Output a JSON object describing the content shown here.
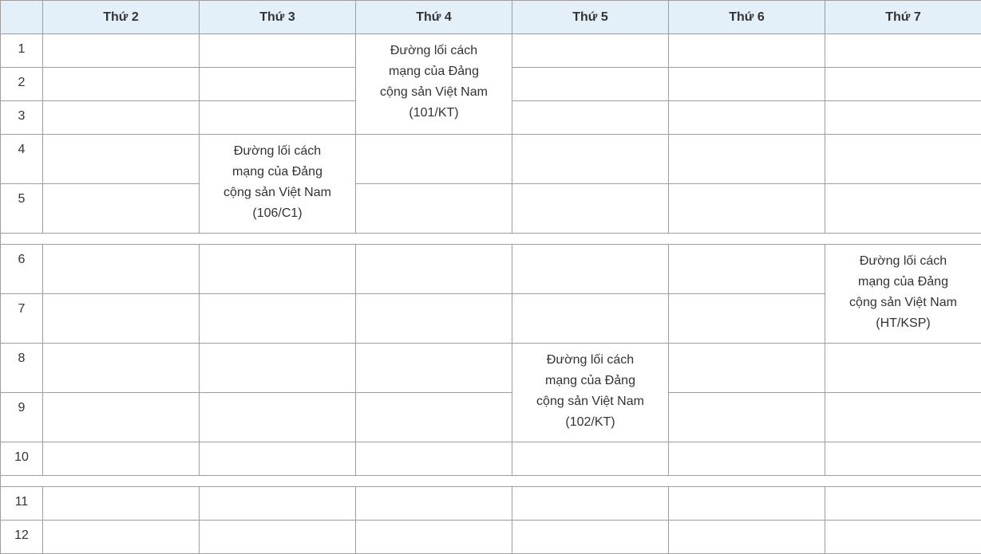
{
  "header": {
    "corner": "",
    "days": [
      "Thứ 2",
      "Thứ 3",
      "Thứ 4",
      "Thứ 5",
      "Thứ 6",
      "Thứ 7"
    ]
  },
  "periods": [
    "1",
    "2",
    "3",
    "4",
    "5",
    "6",
    "7",
    "8",
    "9",
    "10",
    "11",
    "12"
  ],
  "courses": {
    "c101": {
      "lines": [
        "Đường lối cách",
        "mạng của Đảng",
        "cộng sản Việt Nam",
        "(101/KT)"
      ]
    },
    "c106": {
      "lines": [
        "Đường lối cách",
        "mạng của Đảng",
        "cộng sản Việt Nam",
        "(106/C1)"
      ]
    },
    "cht": {
      "lines": [
        "Đường lối cách",
        "mạng của Đảng",
        "cộng sản Việt Nam",
        "(HT/KSP)"
      ]
    },
    "c102": {
      "lines": [
        "Đường lối cách",
        "mạng của Đảng",
        "cộng sản Việt Nam",
        "(102/KT)"
      ]
    }
  },
  "colors": {
    "header_bg": "#e3f0fa",
    "border": "#9e9e9e",
    "text": "#333333"
  }
}
